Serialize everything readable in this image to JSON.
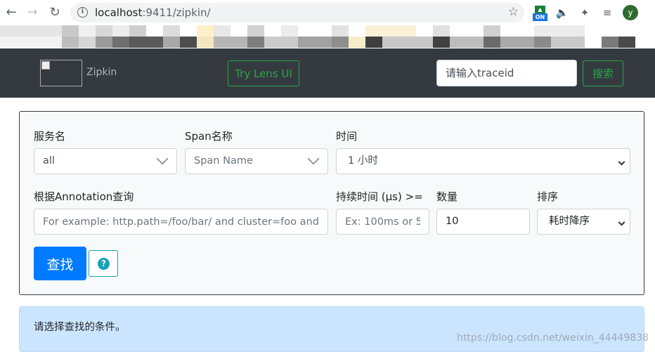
{
  "browser": {
    "url_host": "localhost",
    "url_path": ":9411/zipkin/",
    "ext_on_label": "ON",
    "avatar_letter": "y"
  },
  "navbar": {
    "brand": "Zipkin",
    "lens_button": "Try Lens UI",
    "traceid_placeholder": "请输入traceid",
    "search_button": "搜索"
  },
  "search": {
    "service_label": "服务名",
    "service_value": "all",
    "span_label": "Span名称",
    "span_placeholder": "Span Name",
    "time_label": "时间",
    "time_value": "1 小时",
    "annotation_label": "根据Annotation查询",
    "annotation_placeholder": "For example: http.path=/foo/bar/ and cluster=foo and c",
    "duration_label": "持续时间 (μs) >=",
    "duration_placeholder": "Ex: 100ms or 5s",
    "limit_label": "数量",
    "limit_value": "10",
    "sort_label": "排序",
    "sort_value": "耗时降序",
    "find_button": "查找",
    "help_icon": "?"
  },
  "alert": {
    "message": "请选择查找的条件。"
  },
  "watermark": "https://blog.csdn.net/weixin_44449838",
  "colors": {
    "navbar_bg": "#343a40",
    "success": "#28a745",
    "primary": "#007bff",
    "info": "#17a2b8",
    "alert_bg": "#cce5ff"
  }
}
